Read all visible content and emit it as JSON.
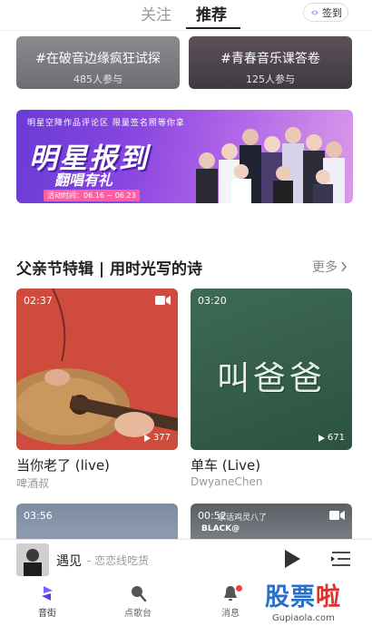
{
  "top": {
    "tab_follow": "关注",
    "tab_recommend": "推荐",
    "checkin_label": "签到",
    "checkin_icon": "checkin-icon"
  },
  "topics": [
    {
      "title": "#在破音边缘疯狂试探",
      "count": "485人参与"
    },
    {
      "title": "#青春音乐课答卷",
      "count": "125人参与"
    }
  ],
  "banner": {
    "tagline": "明星空降作品评论区  限量签名照等你拿",
    "title": "明星报到",
    "subtitle": "翻唱有礼",
    "time": "活动时间：06.16 ~ 06.23"
  },
  "section": {
    "title": "父亲节特辑 | 用时光写的诗",
    "more": "更多"
  },
  "videos": [
    {
      "duration": "02:37",
      "plays": "377",
      "title": "当你老了 (live)",
      "author": "啤酒叔"
    },
    {
      "duration": "03:20",
      "plays": "671",
      "title": "单车 (Live)",
      "author": "DwyaneChen",
      "cover_text": "叫爸爸"
    },
    {
      "duration": "03:56"
    },
    {
      "duration": "00:52",
      "overlay1": "家话鸡灵八了",
      "overlay2": "BLACK@"
    }
  ],
  "player": {
    "song": "遇见",
    "artist": "- 恋恋线吃货"
  },
  "nav": {
    "items": [
      {
        "label": "音街",
        "icon": "music-street-icon"
      },
      {
        "label": "点歌台",
        "icon": "mic-icon"
      },
      {
        "label": "消息",
        "icon": "bell-icon"
      }
    ]
  },
  "watermark": {
    "text": "股票",
    "text_red": "啦",
    "url": "Gupiaola.com"
  },
  "colors": {
    "banner_purple": "#8a46e0",
    "accent_red": "#ff3a3a"
  }
}
